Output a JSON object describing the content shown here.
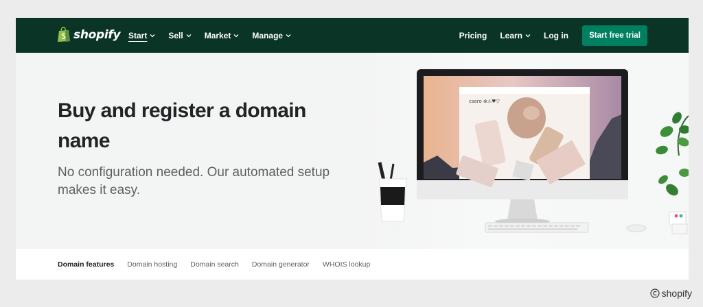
{
  "header": {
    "brand": "shopify",
    "nav_left": [
      {
        "label": "Start",
        "dropdown": true,
        "active": true
      },
      {
        "label": "Sell",
        "dropdown": true
      },
      {
        "label": "Market",
        "dropdown": true
      },
      {
        "label": "Manage",
        "dropdown": true
      }
    ],
    "nav_right": [
      {
        "label": "Pricing",
        "dropdown": false
      },
      {
        "label": "Learn",
        "dropdown": true
      },
      {
        "label": "Log in",
        "dropdown": false
      }
    ],
    "cta_label": "Start free trial"
  },
  "hero": {
    "title": "Buy and register a domain name",
    "subtitle": "No configuration needed. Our automated setup makes it easy.",
    "screen_brand": "csero ⊗⚠♥▽"
  },
  "subnav": {
    "items": [
      "Domain features",
      "Domain hosting",
      "Domain search",
      "Domain generator",
      "WHOIS lookup"
    ]
  },
  "watermark": "shopify",
  "colors": {
    "nav_bg": "#0a3526",
    "cta_bg": "#008060",
    "hero_bg": "#f3f4f4",
    "title": "#212326",
    "subtitle": "#5c5f62"
  }
}
